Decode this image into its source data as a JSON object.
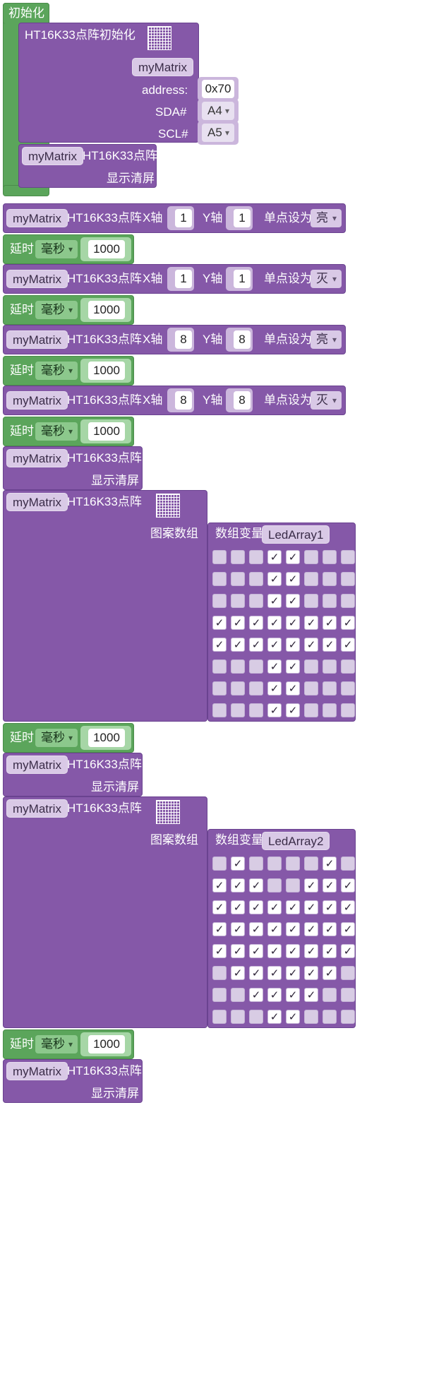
{
  "init": {
    "hat_label": "初始化",
    "matrix_block": {
      "title": "HT16K33点阵初始化",
      "var": "myMatrix",
      "address_label": "address:",
      "address_value": "0x70",
      "sda_label": "SDA#",
      "sda_value": "A4",
      "scl_label": "SCL#",
      "scl_value": "A5"
    },
    "clear_block": {
      "var": "myMatrix",
      "title": "HT16K33点阵",
      "action": "显示清屏"
    }
  },
  "pixel_blocks": [
    {
      "var": "myMatrix",
      "title": "HT16K33点阵",
      "x_label": "X轴",
      "x": "1",
      "y_label": "Y轴",
      "y": "1",
      "set_label": "单点设为",
      "state": "亮"
    },
    {
      "var": "myMatrix",
      "title": "HT16K33点阵",
      "x_label": "X轴",
      "x": "1",
      "y_label": "Y轴",
      "y": "1",
      "set_label": "单点设为",
      "state": "灭"
    },
    {
      "var": "myMatrix",
      "title": "HT16K33点阵",
      "x_label": "X轴",
      "x": "8",
      "y_label": "Y轴",
      "y": "8",
      "set_label": "单点设为",
      "state": "亮"
    },
    {
      "var": "myMatrix",
      "title": "HT16K33点阵",
      "x_label": "X轴",
      "x": "8",
      "y_label": "Y轴",
      "y": "8",
      "set_label": "单点设为",
      "state": "灭"
    }
  ],
  "delays": [
    {
      "label": "延时",
      "unit": "毫秒",
      "value": "1000"
    },
    {
      "label": "延时",
      "unit": "毫秒",
      "value": "1000"
    },
    {
      "label": "延时",
      "unit": "毫秒",
      "value": "1000"
    },
    {
      "label": "延时",
      "unit": "毫秒",
      "value": "1000"
    },
    {
      "label": "延时",
      "unit": "毫秒",
      "value": "1000"
    },
    {
      "label": "延时",
      "unit": "毫秒",
      "value": "1000"
    }
  ],
  "clear_blocks": [
    {
      "var": "myMatrix",
      "title": "HT16K33点阵",
      "action": "显示清屏"
    },
    {
      "var": "myMatrix",
      "title": "HT16K33点阵",
      "action": "显示清屏"
    },
    {
      "var": "myMatrix",
      "title": "HT16K33点阵",
      "action": "显示清屏"
    }
  ],
  "pattern_blocks": [
    {
      "var": "myMatrix",
      "title": "HT16K33点阵",
      "pattern_label": "图案数组",
      "array_label": "数组变量",
      "array_name": "LedArray1",
      "grid": [
        [
          0,
          0,
          0,
          1,
          1,
          0,
          0,
          0
        ],
        [
          0,
          0,
          0,
          1,
          1,
          0,
          0,
          0
        ],
        [
          0,
          0,
          0,
          1,
          1,
          0,
          0,
          0
        ],
        [
          1,
          1,
          1,
          1,
          1,
          1,
          1,
          1
        ],
        [
          1,
          1,
          1,
          1,
          1,
          1,
          1,
          1
        ],
        [
          0,
          0,
          0,
          1,
          1,
          0,
          0,
          0
        ],
        [
          0,
          0,
          0,
          1,
          1,
          0,
          0,
          0
        ],
        [
          0,
          0,
          0,
          1,
          1,
          0,
          0,
          0
        ]
      ]
    },
    {
      "var": "myMatrix",
      "title": "HT16K33点阵",
      "pattern_label": "图案数组",
      "array_label": "数组变量",
      "array_name": "LedArray2",
      "grid": [
        [
          0,
          1,
          0,
          0,
          0,
          0,
          1,
          0
        ],
        [
          1,
          1,
          1,
          0,
          0,
          1,
          1,
          1
        ],
        [
          1,
          1,
          1,
          1,
          1,
          1,
          1,
          1
        ],
        [
          1,
          1,
          1,
          1,
          1,
          1,
          1,
          1
        ],
        [
          1,
          1,
          1,
          1,
          1,
          1,
          1,
          1
        ],
        [
          0,
          1,
          1,
          1,
          1,
          1,
          1,
          0
        ],
        [
          0,
          0,
          1,
          1,
          1,
          1,
          0,
          0
        ],
        [
          0,
          0,
          0,
          1,
          1,
          0,
          0,
          0
        ]
      ]
    }
  ],
  "check_glyph": "✓",
  "colors": {
    "purple": "#8558a8",
    "green": "#5ba55b"
  }
}
